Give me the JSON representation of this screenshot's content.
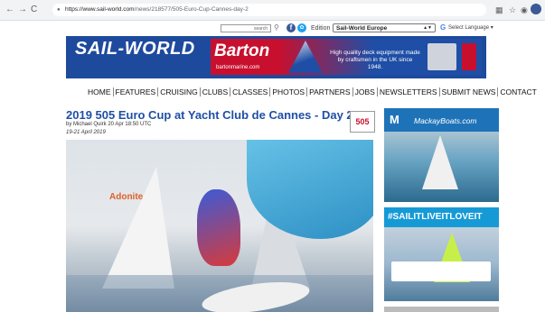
{
  "browser": {
    "nav": {
      "back": "←",
      "forward": "→",
      "reload": "C"
    },
    "url_host": "https://www.sail-world.com",
    "url_path": "/news/218577/505-Euro-Cup-Cannes-day-2"
  },
  "toolbar": {
    "search_placeholder": "search",
    "edition_label": "Edition",
    "edition_value": "Sail-World Europe",
    "language_label": "Select Language"
  },
  "header": {
    "logo": "SAIL-WORLD",
    "ad": {
      "brand": "Barton",
      "url": "bartonmarine.com",
      "tagline": "High quality deck equipment made by craftsmen in the UK since 1948."
    }
  },
  "nav": {
    "items": [
      "HOME",
      "FEATURES",
      "CRUISING",
      "CLUBS",
      "CLASSES",
      "PHOTOS",
      "PARTNERS",
      "JOBS",
      "NEWSLETTERS",
      "SUBMIT NEWS",
      "CONTACT"
    ]
  },
  "article": {
    "title": "2019 505 Euro Cup at Yacht Club de Cannes - Day 2",
    "byline": "by Michael Quirk 20 Apr 18:50 UTC",
    "dates": "19-21 April 2019",
    "class_logo": "505",
    "hero_sail_label": "Adonite"
  },
  "sidebar": {
    "ad1": {
      "logo": "M",
      "text": "MackayBoats.com"
    },
    "ad2": {
      "text": "#SAILITLIVEITLOVEIT"
    }
  }
}
